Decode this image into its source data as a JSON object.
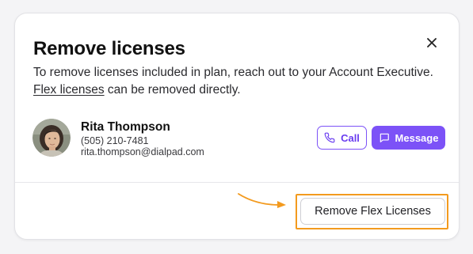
{
  "dialog": {
    "title": "Remove licenses",
    "description_prefix": "To remove licenses included in plan, reach out to your Account Executive.",
    "flex_link": "Flex licenses",
    "description_suffix": " can be removed directly.",
    "close_icon": "close-icon"
  },
  "contact": {
    "name": "Rita Thompson",
    "phone": "(505) 210-7481",
    "email": "rita.thompson@dialpad.com",
    "avatar_icon": "avatar-photo"
  },
  "actions": {
    "call_label": "Call",
    "call_icon": "phone-icon",
    "message_label": "Message",
    "message_icon": "chat-bubble-icon",
    "remove_label": "Remove Flex Licenses"
  },
  "colors": {
    "accent": "#7c52f7",
    "highlight": "#f39a1e"
  }
}
